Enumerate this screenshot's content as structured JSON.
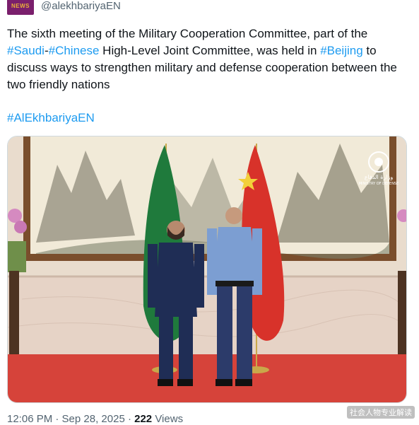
{
  "account": {
    "avatar_text": "NEWS",
    "handle": "@alekhbariyaEN"
  },
  "tweet": {
    "text_parts": [
      {
        "t": "The sixth meeting of the Military Cooperation Committee, part of the ",
        "tag": false
      },
      {
        "t": "#Saudi",
        "tag": true
      },
      {
        "t": "-",
        "tag": false
      },
      {
        "t": "#Chinese",
        "tag": true
      },
      {
        "t": " High-Level Joint Committee, was held in ",
        "tag": false
      },
      {
        "t": "#Beijing",
        "tag": true
      },
      {
        "t": " to discuss ways to strengthen military and defense cooperation between the two friendly nations",
        "tag": false
      }
    ],
    "hashtag_line": "#AlEkhbariyaEN"
  },
  "photo": {
    "logo_text": "وزارة الدفاع",
    "logo_subtext": "MINISTRY OF DEFENSE"
  },
  "meta": {
    "time_date": "12:06 PM · Sep 28, 2025 · ",
    "views_count": "222",
    "views_label": " Views"
  },
  "watermark": "社会人物专业解读"
}
